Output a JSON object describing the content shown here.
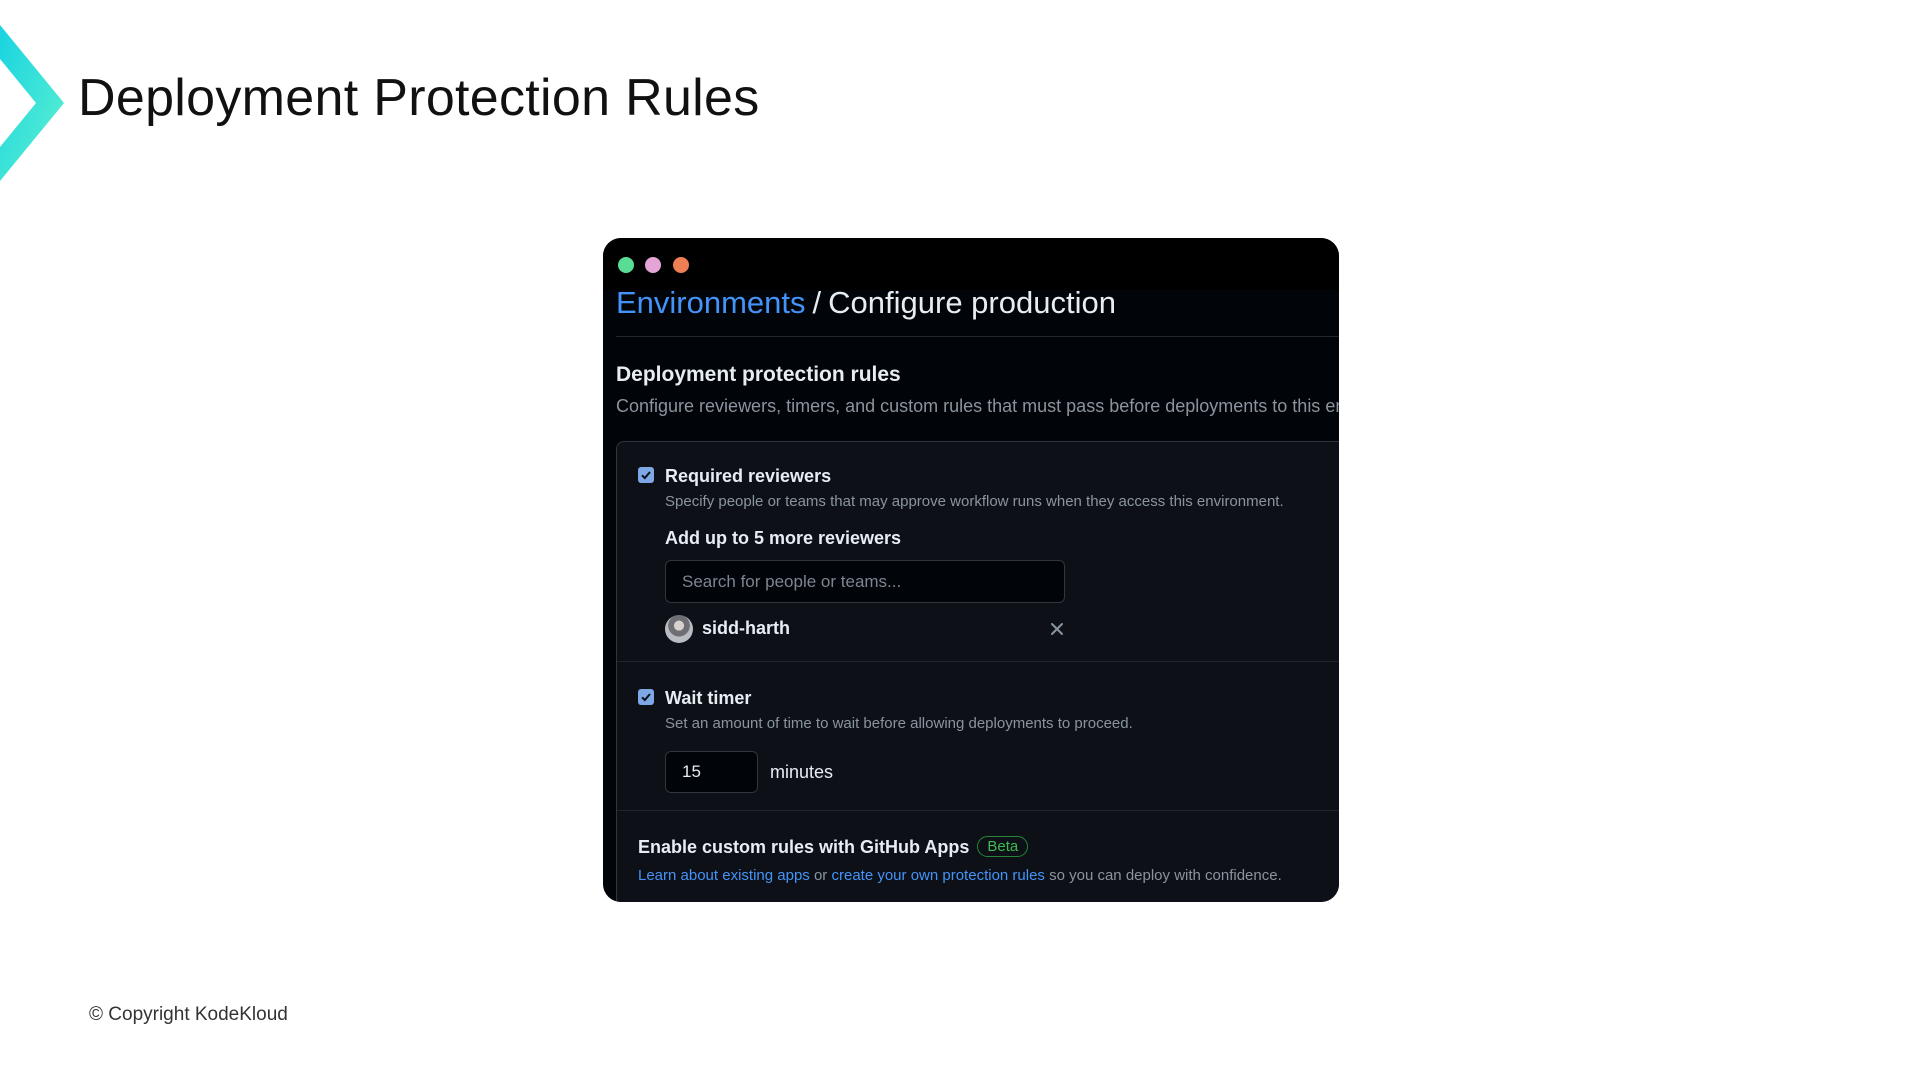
{
  "slide": {
    "title": "Deployment Protection Rules",
    "copyright": "© Copyright KodeKloud",
    "logo_gradient": [
      "#5ef2d0",
      "#19d3e0"
    ]
  },
  "window": {
    "colors": {
      "background": "#010409",
      "panel": "#0d1117",
      "link": "#4493f8",
      "text": "#e6edf3",
      "muted": "#8b949e",
      "beta": "#3fb950",
      "dot_green": "#59dd95",
      "dot_pink": "#e5a4d6",
      "dot_orange": "#ee7e53"
    },
    "breadcrumb": {
      "link": "Environments",
      "separator": "/",
      "current": "Configure production"
    },
    "section": {
      "title": "Deployment protection rules",
      "description": "Configure reviewers, timers, and custom rules that must pass before deployments to this environment can proceed."
    },
    "required_reviewers": {
      "checked": true,
      "title": "Required reviewers",
      "description": "Specify people or teams that may approve workflow runs when they access this environment.",
      "add_label": "Add up to 5 more reviewers",
      "search_placeholder": "Search for people or teams...",
      "reviewer": "sidd-harth",
      "remove_icon": "close-icon"
    },
    "wait_timer": {
      "checked": true,
      "title": "Wait timer",
      "description": "Set an amount of time to wait before allowing deployments to proceed.",
      "value": "15",
      "unit": "minutes"
    },
    "custom_rules": {
      "title": "Enable custom rules with GitHub Apps",
      "badge": "Beta",
      "link1": "Learn about existing apps",
      "connector": " or ",
      "link2": "create your own protection rules",
      "suffix": " so you can deploy with confidence."
    }
  }
}
